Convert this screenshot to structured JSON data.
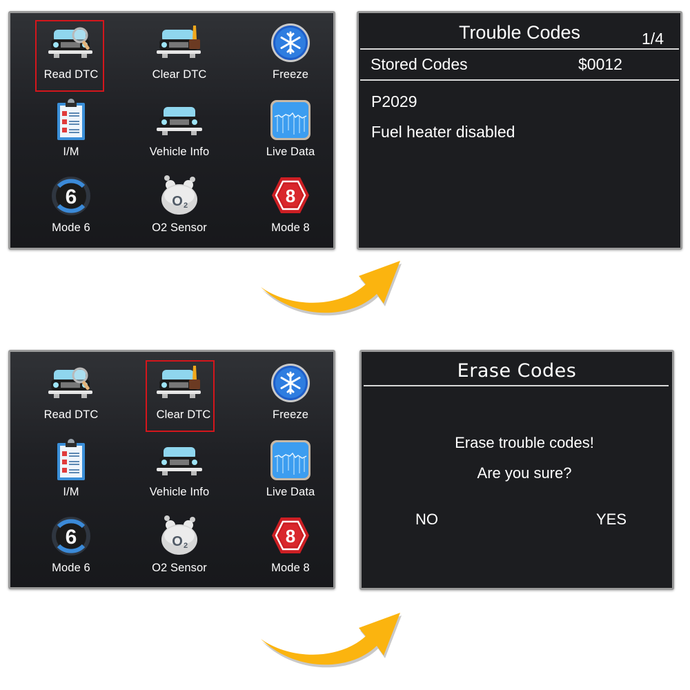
{
  "menu": {
    "items": [
      {
        "id": "read-dtc",
        "label": "Read DTC",
        "icon": "car-magnifier-icon"
      },
      {
        "id": "clear-dtc",
        "label": "Clear DTC",
        "icon": "car-brush-icon"
      },
      {
        "id": "freeze",
        "label": "Freeze",
        "icon": "snowflake-icon"
      },
      {
        "id": "im",
        "label": "I/M",
        "icon": "clipboard-checklist-icon"
      },
      {
        "id": "vehicle-info",
        "label": "Vehicle Info",
        "icon": "car-icon"
      },
      {
        "id": "live-data",
        "label": "Live Data",
        "icon": "waveform-icon"
      },
      {
        "id": "mode-6",
        "label": "Mode 6",
        "icon": "mode-6-icon",
        "glyph": "6"
      },
      {
        "id": "o2-sensor",
        "label": "O2 Sensor",
        "icon": "o2-bubble-icon",
        "glyph": "O",
        "sub": "2"
      },
      {
        "id": "mode-8",
        "label": "Mode 8",
        "icon": "mode-8-hexagon-icon",
        "glyph": "8"
      }
    ],
    "selected_top": "Read DTC",
    "selected_bottom": "Clear DTC",
    "selection_color": "#d4161c"
  },
  "trouble_codes": {
    "title": "Trouble Codes",
    "page": "1/4",
    "section_label": "Stored Codes",
    "section_value": "$0012",
    "code": "P2029",
    "description": "Fuel heater disabled"
  },
  "erase_codes": {
    "title": "Erase Codes",
    "message": "Erase trouble codes!",
    "question": "Are you sure?",
    "no_label": "NO",
    "yes_label": "YES"
  },
  "colors": {
    "arrow": "#fbb40f",
    "screen_border": "#9a9a9a"
  }
}
